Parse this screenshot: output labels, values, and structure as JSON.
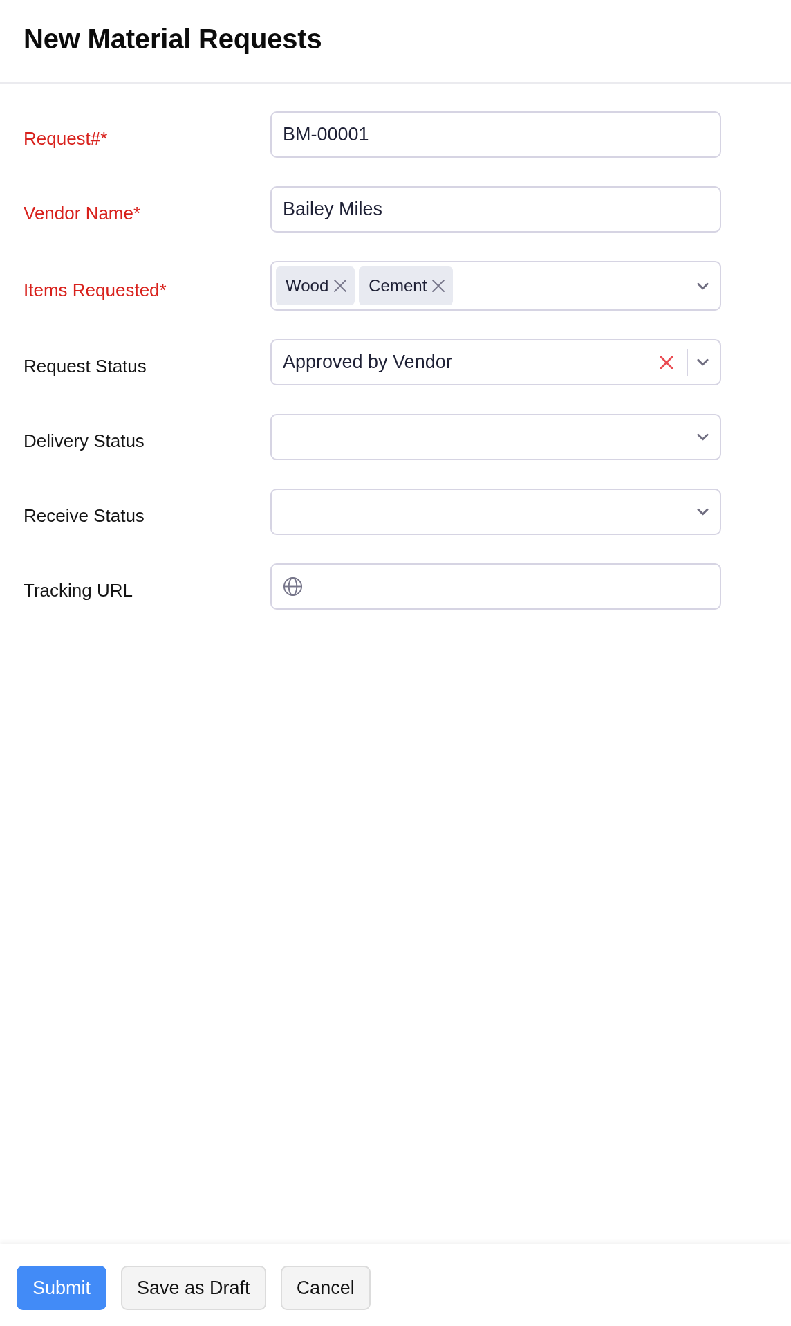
{
  "header": {
    "title": "New Material Requests"
  },
  "fields": [
    {
      "label": "Request#*",
      "required": true,
      "kind": "text",
      "value": "BM-00001"
    },
    {
      "label": "Vendor Name*",
      "required": true,
      "kind": "text",
      "value": "Bailey Miles"
    },
    {
      "label": "Items Requested*",
      "required": true,
      "kind": "multiselect",
      "tags": [
        "Wood",
        "Cement"
      ]
    },
    {
      "label": "Request Status",
      "required": false,
      "kind": "select",
      "value": "Approved by Vendor"
    },
    {
      "label": "Delivery Status",
      "required": false,
      "kind": "select"
    },
    {
      "label": "Receive Status",
      "required": false,
      "kind": "select"
    },
    {
      "label": "Tracking URL",
      "required": false,
      "kind": "url"
    }
  ],
  "buttons": [
    {
      "label": "Submit",
      "kind": "primary"
    },
    {
      "label": "Save as Draft",
      "kind": "secondary"
    },
    {
      "label": "Cancel",
      "kind": "secondary"
    }
  ]
}
